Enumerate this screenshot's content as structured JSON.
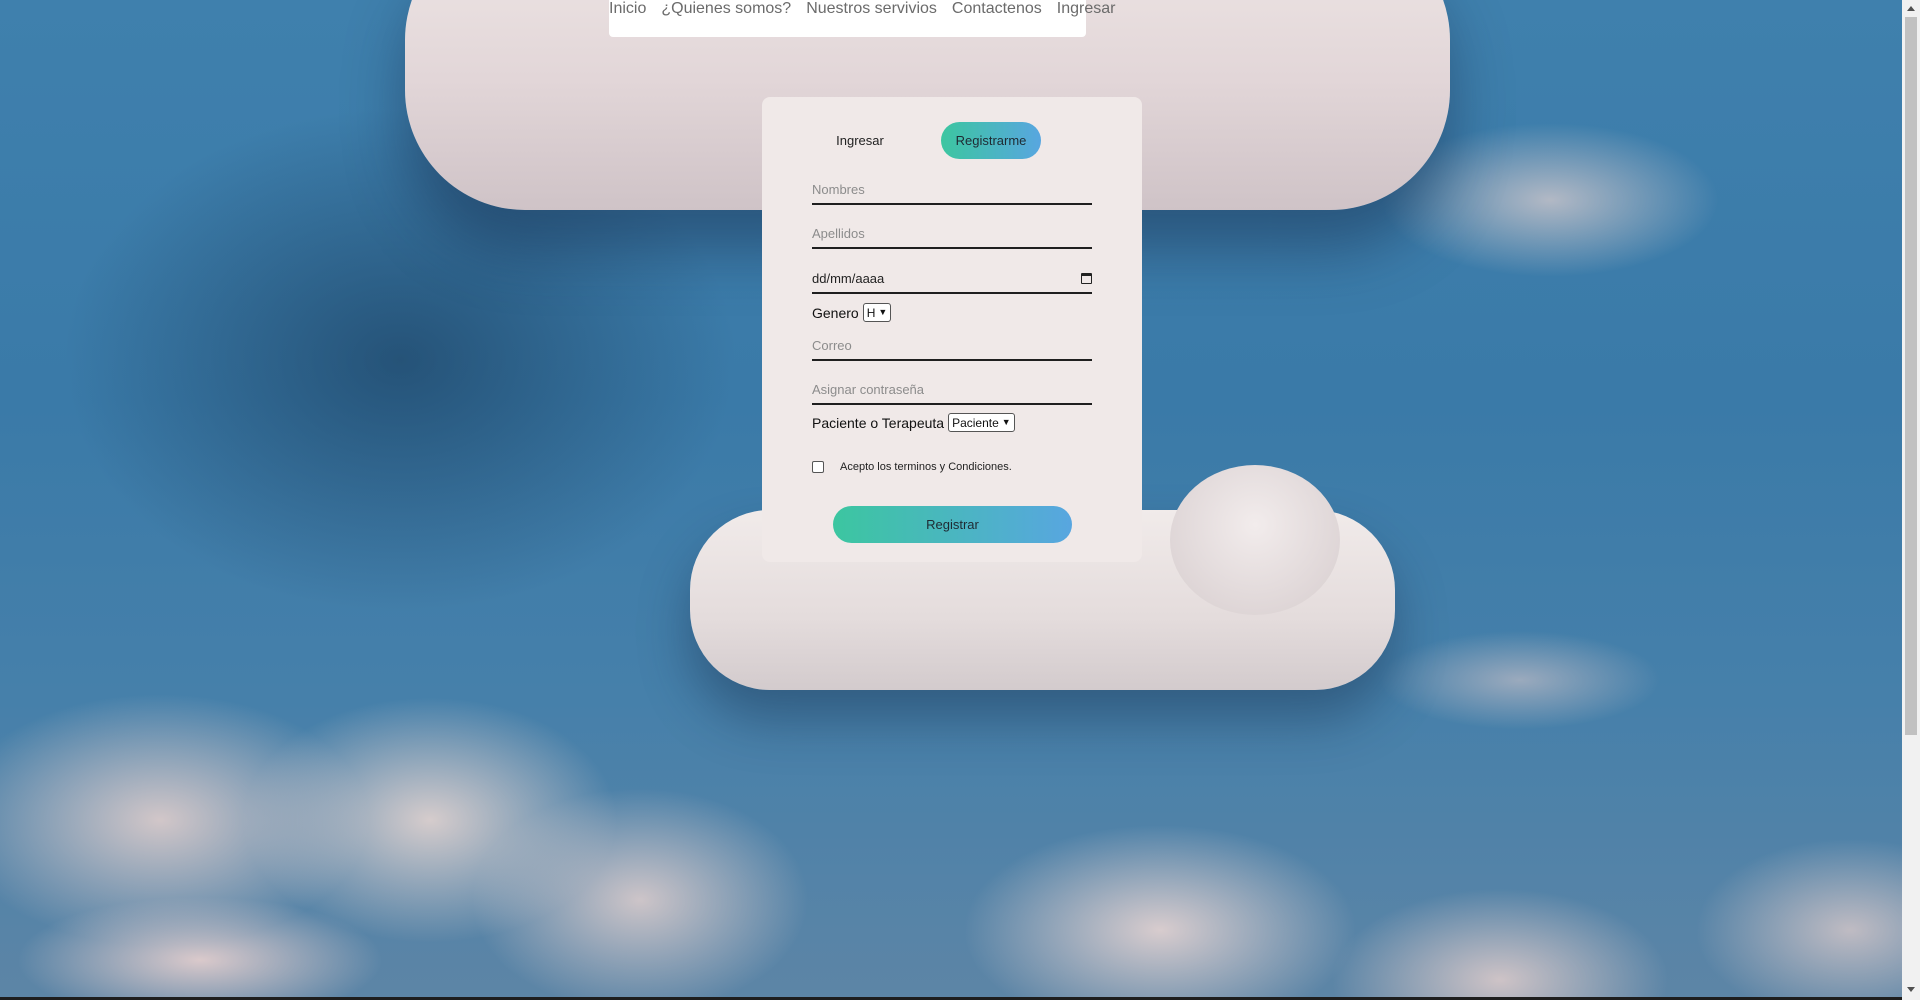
{
  "nav": {
    "links": [
      "Inicio",
      "¿Quienes somos?",
      "Nuestros servivios",
      "Contactenos",
      "Ingresar"
    ]
  },
  "form": {
    "tab_login": "Ingresar",
    "tab_register": "Registrarme",
    "first_name_placeholder": "Nombres",
    "last_name_placeholder": "Apellidos",
    "date_value": "dd/mm/aaaa",
    "gender_label": "Genero",
    "gender_selected": "H",
    "email_placeholder": "Correo",
    "password_placeholder": "Asignar contraseña",
    "role_label": "Paciente o Terapeuta",
    "role_selected": "Paciente",
    "terms_text": "Acepto los terminos y Condiciones.",
    "terms_checked": false,
    "submit_label": "Registrar"
  },
  "colors": {
    "card_bg": "#f0e9e8",
    "button_gradient_start": "#3cc6a0",
    "button_gradient_end": "#58a6e0"
  },
  "icons": {
    "date": "calendar-icon",
    "select": "chevron-down-icon",
    "scroll_up": "arrow-up-icon",
    "scroll_down": "arrow-down-icon"
  }
}
